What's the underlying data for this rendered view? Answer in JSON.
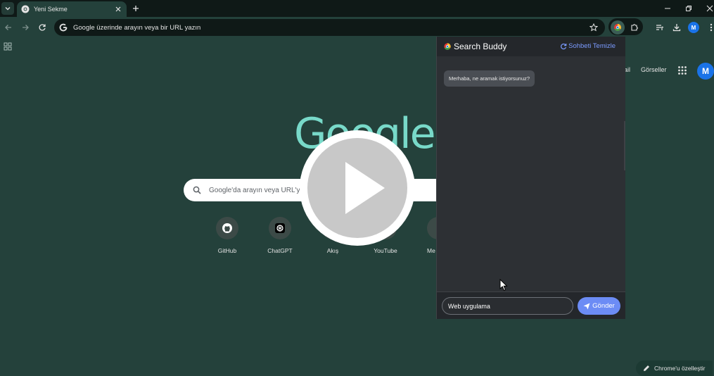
{
  "tabs": [
    {
      "title": "Yeni Sekme"
    }
  ],
  "omnibox": {
    "placeholder": "Google üzerinde arayın veya bir URL yazın"
  },
  "ntp": {
    "header_links": {
      "gmail_partial": "ail",
      "images": "Görseller"
    },
    "profile_initial": "M",
    "logo": "Google",
    "search_placeholder": "Google'da arayın veya URL'yi",
    "shortcuts": [
      {
        "label": "GitHub",
        "icon": "github-icon"
      },
      {
        "label": "ChatGPT",
        "icon": "chatgpt-icon"
      },
      {
        "label": "Akış",
        "icon": "feed-icon"
      },
      {
        "label": "YouTube",
        "icon": "youtube-icon"
      },
      {
        "label": "Me",
        "icon": "shortcut-icon"
      }
    ],
    "customize_label": "Chrome'u özelleştir"
  },
  "toolbar": {
    "profile_initial": "M"
  },
  "extension_popup": {
    "title": "Search Buddy",
    "clear_label": "Sohbeti Temizle",
    "messages": [
      {
        "role": "bot",
        "text": "Merhaba, ne aramak istiyorsunuz?"
      }
    ],
    "input_value": "Web uygulama",
    "send_label": "Gönder"
  },
  "colors": {
    "page_bg": "#24413b",
    "tabstrip_bg": "#0f1917",
    "google_logo": "#78d9c9",
    "popup_bg": "#2d3034",
    "accent": "#6c8cf5"
  }
}
